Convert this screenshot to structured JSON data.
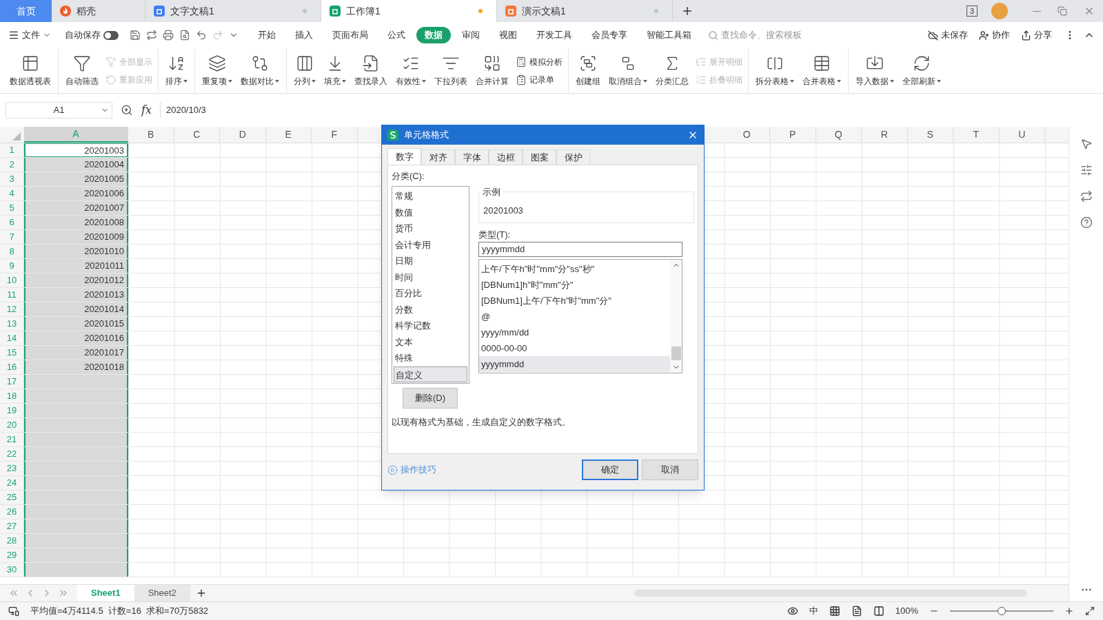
{
  "doc_tabs": [
    {
      "kind": "home",
      "label": "首页",
      "selected": false
    },
    {
      "kind": "daoke",
      "label": "稻壳",
      "selected": false
    },
    {
      "kind": "writer",
      "label": "文字文稿1",
      "selected": false,
      "modified": false
    },
    {
      "kind": "sheet",
      "label": "工作簿1",
      "selected": true,
      "modified": true
    },
    {
      "kind": "slides",
      "label": "演示文稿1",
      "selected": false,
      "modified": false
    }
  ],
  "window_badge": "3",
  "menu": {
    "file": "文件",
    "autosave": {
      "label": "自动保存",
      "on": false
    },
    "tabs": [
      {
        "label": "开始",
        "selected": false
      },
      {
        "label": "插入",
        "selected": false
      },
      {
        "label": "页面布局",
        "selected": false
      },
      {
        "label": "公式",
        "selected": false
      },
      {
        "label": "数据",
        "selected": true
      },
      {
        "label": "审阅",
        "selected": false
      },
      {
        "label": "视图",
        "selected": false
      },
      {
        "label": "开发工具",
        "selected": false
      },
      {
        "label": "会员专享",
        "selected": false
      },
      {
        "label": "智能工具箱",
        "selected": false
      }
    ],
    "search_placeholder": "查找命令、搜索模板",
    "actions": [
      "未保存",
      "协作",
      "分享"
    ]
  },
  "ribbon": [
    [
      {
        "kind": "large",
        "label": "数据透视表",
        "dropdown": false
      }
    ],
    [
      {
        "kind": "large",
        "label": "自动筛选",
        "dropdown": false
      },
      {
        "kind": "pair",
        "items": [
          {
            "label": "全部显示",
            "disabled": true
          },
          {
            "label": "重新应用",
            "disabled": true
          }
        ]
      }
    ],
    [
      {
        "kind": "large",
        "label": "排序",
        "dropdown": true
      }
    ],
    [
      {
        "kind": "large",
        "label": "重复项",
        "dropdown": true
      },
      {
        "kind": "large",
        "label": "数据对比",
        "dropdown": true
      }
    ],
    [
      {
        "kind": "large",
        "label": "分列",
        "dropdown": true
      },
      {
        "kind": "large",
        "label": "填充",
        "dropdown": true
      },
      {
        "kind": "large",
        "label": "查找录入",
        "dropdown": false
      },
      {
        "kind": "large",
        "label": "有效性",
        "dropdown": true
      },
      {
        "kind": "large",
        "label": "下拉列表",
        "dropdown": false
      },
      {
        "kind": "large",
        "label": "合并计算",
        "dropdown": false
      },
      {
        "kind": "pair",
        "items": [
          {
            "label": "模拟分析",
            "disabled": false
          },
          {
            "label": "记录单",
            "disabled": false
          }
        ]
      }
    ],
    [
      {
        "kind": "large",
        "label": "创建组",
        "dropdown": false
      },
      {
        "kind": "large",
        "label": "取消组合",
        "dropdown": true
      },
      {
        "kind": "large",
        "label": "分类汇总",
        "dropdown": false
      },
      {
        "kind": "pair",
        "items": [
          {
            "label": "展开明细",
            "disabled": true
          },
          {
            "label": "折叠明细",
            "disabled": true
          }
        ]
      }
    ],
    [
      {
        "kind": "large",
        "label": "拆分表格",
        "dropdown": true
      },
      {
        "kind": "large",
        "label": "合并表格",
        "dropdown": true
      }
    ],
    [
      {
        "kind": "large",
        "label": "导入数据",
        "dropdown": true
      },
      {
        "kind": "large",
        "label": "全部刷新",
        "dropdown": true
      }
    ]
  ],
  "formula_bar": {
    "name_box": "A1",
    "fx": "fx",
    "value": "2020/10/3"
  },
  "columns_left": [
    {
      "label": "A",
      "selected": true
    },
    {
      "label": "B",
      "selected": false
    },
    {
      "label": "C",
      "selected": false
    },
    {
      "label": "D",
      "selected": false
    },
    {
      "label": "E",
      "selected": false
    },
    {
      "label": "F",
      "selected": false
    }
  ],
  "columns_right": [
    {
      "label": "O",
      "selected": false
    },
    {
      "label": "P",
      "selected": false
    },
    {
      "label": "Q",
      "selected": false
    },
    {
      "label": "R",
      "selected": false
    },
    {
      "label": "S",
      "selected": false
    },
    {
      "label": "T",
      "selected": false
    },
    {
      "label": "U",
      "selected": false
    }
  ],
  "rows": [
    {
      "number": "1",
      "value": "20201003",
      "active": true
    },
    {
      "number": "2",
      "value": "20201004",
      "active": false
    },
    {
      "number": "3",
      "value": "20201005",
      "active": false
    },
    {
      "number": "4",
      "value": "20201006",
      "active": false
    },
    {
      "number": "5",
      "value": "20201007",
      "active": false
    },
    {
      "number": "6",
      "value": "20201008",
      "active": false
    },
    {
      "number": "7",
      "value": "20201009",
      "active": false
    },
    {
      "number": "8",
      "value": "20201010",
      "active": false
    },
    {
      "number": "9",
      "value": "20201011",
      "active": false
    },
    {
      "number": "10",
      "value": "20201012",
      "active": false
    },
    {
      "number": "11",
      "value": "20201013",
      "active": false
    },
    {
      "number": "12",
      "value": "20201014",
      "active": false
    },
    {
      "number": "13",
      "value": "20201015",
      "active": false
    },
    {
      "number": "14",
      "value": "20201016",
      "active": false
    },
    {
      "number": "15",
      "value": "20201017",
      "active": false
    },
    {
      "number": "16",
      "value": "20201018",
      "active": false
    },
    {
      "number": "17",
      "active": false
    },
    {
      "number": "18",
      "active": false
    },
    {
      "number": "19",
      "active": false
    },
    {
      "number": "20",
      "active": false
    },
    {
      "number": "21",
      "active": false
    },
    {
      "number": "22",
      "active": false
    },
    {
      "number": "23",
      "active": false
    },
    {
      "number": "24",
      "active": false
    },
    {
      "number": "25",
      "active": false
    },
    {
      "number": "26",
      "active": false
    },
    {
      "number": "27",
      "active": false
    },
    {
      "number": "28",
      "active": false
    },
    {
      "number": "29",
      "active": false
    },
    {
      "number": "30",
      "active": false
    }
  ],
  "sheet_tabs": [
    {
      "label": "Sheet1",
      "selected": true
    },
    {
      "label": "Sheet2",
      "selected": false
    }
  ],
  "status_bar": {
    "stats": "平均值=4万4114.5  计数=16  求和=70万5832",
    "input_method": "中",
    "zoom": "100%",
    "zoom_level": {
      "level": 0.5
    }
  },
  "dialog": {
    "title": "单元格格式",
    "tabs": [
      {
        "label": "数字",
        "selected": true
      },
      {
        "label": "对齐",
        "selected": false
      },
      {
        "label": "字体",
        "selected": false
      },
      {
        "label": "边框",
        "selected": false
      },
      {
        "label": "图案",
        "selected": false
      },
      {
        "label": "保护",
        "selected": false
      }
    ],
    "category_label": "分类(C):",
    "categories": [
      {
        "label": "常规",
        "selected": false
      },
      {
        "label": "数值",
        "selected": false
      },
      {
        "label": "货币",
        "selected": false
      },
      {
        "label": "会计专用",
        "selected": false
      },
      {
        "label": "日期",
        "selected": false
      },
      {
        "label": "时间",
        "selected": false
      },
      {
        "label": "百分比",
        "selected": false
      },
      {
        "label": "分数",
        "selected": false
      },
      {
        "label": "科学记数",
        "selected": false
      },
      {
        "label": "文本",
        "selected": false
      },
      {
        "label": "特殊",
        "selected": false
      },
      {
        "label": "自定义",
        "selected": true
      }
    ],
    "sample_label": "示例",
    "sample": "20201003",
    "type_label": "类型(T):",
    "type_value": "yyyymmdd",
    "types": [
      {
        "label": "上午/下午h\"时\"mm\"分\"ss\"秒\"",
        "selected": false
      },
      {
        "label": "[DBNum1]h\"时\"mm\"分\"",
        "selected": false
      },
      {
        "label": "[DBNum1]上午/下午h\"时\"mm\"分\"",
        "selected": false
      },
      {
        "label": "@",
        "selected": false
      },
      {
        "label": "yyyy/mm/dd",
        "selected": false
      },
      {
        "label": "0000-00-00",
        "selected": false
      },
      {
        "label": "yyyymmdd",
        "selected": true
      }
    ],
    "delete_button": "删除(D)",
    "description": "以现有格式为基础，生成自定义的数字格式。",
    "help_link": "操作技巧",
    "ok": "确定",
    "cancel": "取消"
  }
}
